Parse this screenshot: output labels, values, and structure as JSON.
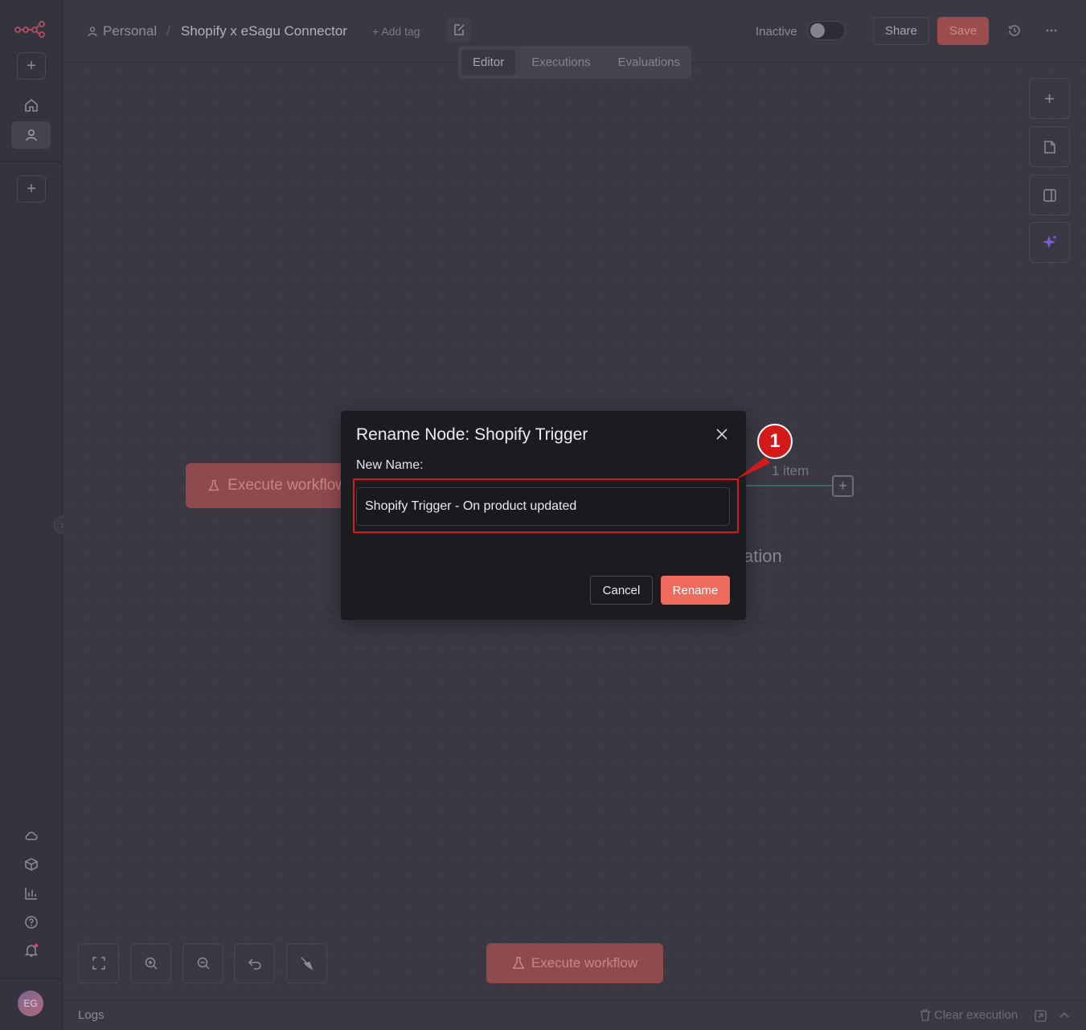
{
  "header": {
    "project_label": "Personal",
    "separator": "/",
    "workflow_name": "Shopify x eSagu  Connector",
    "add_tag": "+ Add tag",
    "status_label": "Inactive",
    "share_label": "Share",
    "save_label": "Save",
    "tabs": [
      {
        "label": "Editor"
      },
      {
        "label": "Executions"
      },
      {
        "label": "Evaluations"
      }
    ]
  },
  "sidebar": {
    "avatar_initials": "EG",
    "collapse_glyph": "›"
  },
  "canvas": {
    "trigger_node_label": "Execute workflow",
    "connection_label": "1 item",
    "partial_node_text": "ation",
    "execute_button_label": "Execute workflow"
  },
  "logs": {
    "label": "Logs",
    "clear_label": "Clear execution"
  },
  "modal": {
    "title": "Rename Node: Shopify Trigger",
    "field_label": "New Name:",
    "input_value": "Shopify Trigger - On product updated",
    "cancel_label": "Cancel",
    "rename_label": "Rename"
  },
  "annotation": {
    "badge_number": "1",
    "color": "#d21a1a"
  },
  "colors": {
    "accent": "#ee6b5d",
    "canvas_bg": "#3a3843",
    "modal_bg": "#1c1b20"
  }
}
